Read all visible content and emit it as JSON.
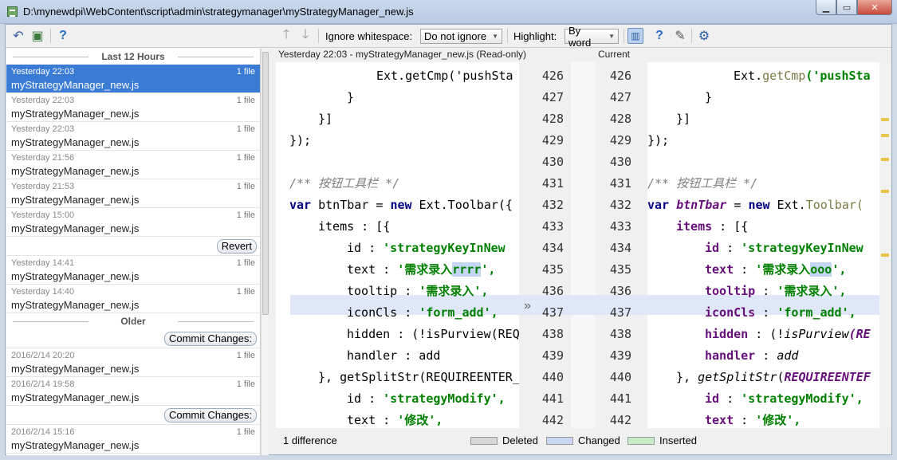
{
  "window": {
    "title": "D:\\mynewdpi\\WebContent\\script\\admin\\strategymanager\\myStrategyManager_new.js"
  },
  "toolbar": {
    "ignore_whitespace_label": "Ignore whitespace:",
    "ignore_whitespace_value": "Do not ignore",
    "highlight_label": "Highlight:",
    "highlight_value": "By word"
  },
  "history": {
    "group_recent": "Last 12 Hours",
    "group_older": "Older",
    "revert_label": "Revert",
    "commit_label": "Commit Changes:",
    "recent_items": [
      {
        "time": "Yesterday 22:03",
        "count": "1 file",
        "file": "myStrategyManager_new.js"
      },
      {
        "time": "Yesterday 22:03",
        "count": "1 file",
        "file": "myStrategyManager_new.js"
      },
      {
        "time": "Yesterday 22:03",
        "count": "1 file",
        "file": "myStrategyManager_new.js"
      },
      {
        "time": "Yesterday 21:56",
        "count": "1 file",
        "file": "myStrategyManager_new.js"
      },
      {
        "time": "Yesterday 21:53",
        "count": "1 file",
        "file": "myStrategyManager_new.js"
      },
      {
        "time": "Yesterday 15:00",
        "count": "1 file",
        "file": "myStrategyManager_new.js"
      },
      {
        "time": "Yesterday 14:41",
        "count": "1 file",
        "file": "myStrategyManager_new.js"
      },
      {
        "time": "Yesterday 14:40",
        "count": "1 file",
        "file": "myStrategyManager_new.js"
      }
    ],
    "older_items": [
      {
        "time": "2016/2/14 20:20",
        "count": "1 file",
        "file": "myStrategyManager_new.js"
      },
      {
        "time": "2016/2/14 19:58",
        "count": "1 file",
        "file": "myStrategyManager_new.js"
      },
      {
        "time": "2016/2/14 15:16",
        "count": "1 file",
        "file": "myStrategyManager_new.js"
      }
    ]
  },
  "diff": {
    "left_header": "Yesterday 22:03 - myStrategyManager_new.js (Read-only)",
    "right_header": "Current",
    "line_numbers": [
      "426",
      "427",
      "428",
      "429",
      "430",
      "431",
      "432",
      "433",
      "434",
      "435",
      "436",
      "437",
      "438",
      "439",
      "440",
      "441",
      "442"
    ],
    "left_lines": {
      "l426": "Ext.getCmp('pushSta",
      "l427": "}",
      "l428": "}]",
      "l429": "});",
      "l431": "/** 按钮工具栏 */",
      "l432_a": "var",
      "l432_b": " btnTbar = ",
      "l432_c": "new",
      "l432_d": " Ext.Toolbar({",
      "l433": "items : [{",
      "l434_a": "id : ",
      "l434_b": "'strategyKeyInNew",
      "l435_a": "text : ",
      "l435_b": "'需求录入",
      "l435_c": "rrrr",
      "l435_d": "',",
      "l436_a": "tooltip : ",
      "l436_b": "'需求录入',",
      "l437_a": "iconCls : ",
      "l437_b": "'form_add',",
      "l438": "hidden : (!isPurview(REQ",
      "l439": "handler : add",
      "l440": "}, getSplitStr(REQUIREENTER_",
      "l441_a": "id : ",
      "l441_b": "'strategyModify',",
      "l442_a": "text : ",
      "l442_b": "'修改',"
    },
    "right_lines": {
      "r426_a": "Ext.",
      "r426_b": "getCmp",
      "r426_c": "('pushSta",
      "r427": "}",
      "r428": "}]",
      "r429": "});",
      "r431": "/** 按钮工具栏 */",
      "r432_a": "var",
      "r432_b": "btnTbar",
      "r432_c": " = ",
      "r432_d": "new",
      "r432_e": " Ext.",
      "r432_f": "Toolbar(",
      "r433_a": "items",
      "r433_b": " : [{",
      "r434_a": "id",
      "r434_b": " : ",
      "r434_c": "'strategyKeyInNew",
      "r435_a": "text",
      "r435_b": " : ",
      "r435_c": "'需求录入",
      "r435_d": "ooo",
      "r435_e": "',",
      "r436_a": "tooltip",
      "r436_b": " : ",
      "r436_c": "'需求录入',",
      "r437_a": "iconCls",
      "r437_b": " : ",
      "r437_c": "'form_add',",
      "r438_a": "hidden",
      "r438_b": " : (!",
      "r438_c": "isPurview",
      "r438_d": "(RE",
      "r439_a": "handler",
      "r439_b": " : ",
      "r439_c": "add",
      "r440_a": "}, ",
      "r440_b": "getSplitStr",
      "r440_c": "(",
      "r440_d": "REQUIREENTEF",
      "r441_a": "id",
      "r441_b": " : ",
      "r441_c": "'strategyModify',",
      "r442_a": "text",
      "r442_b": " : ",
      "r442_c": "'修改',"
    }
  },
  "status": {
    "difference_count": "1 difference",
    "legend_deleted": "Deleted",
    "legend_changed": "Changed",
    "legend_inserted": "Inserted",
    "color_deleted": "#d6d6d6",
    "color_changed": "#c9d7f2",
    "color_inserted": "#c7ecc7"
  }
}
